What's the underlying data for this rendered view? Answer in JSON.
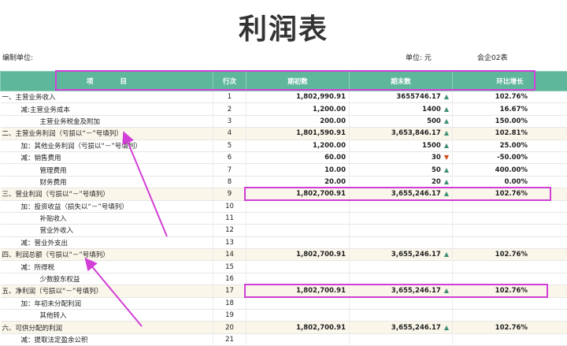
{
  "title": "利润表",
  "meta": {
    "unit_left": "编制单位:",
    "unit": "单位: 元",
    "code": "会企02表"
  },
  "headers": {
    "item": "项　　　　目",
    "line": "行次",
    "begin": "期初数",
    "end": "期末数",
    "growth": "环比增长"
  },
  "rows": [
    {
      "item": "一、主营业务收入",
      "line": "1",
      "begin": "1,802,990.91",
      "end": "3655746.17",
      "dir": "up",
      "growth": "102.76%",
      "indent": 0,
      "hl": false
    },
    {
      "item": "减:主营业务成本",
      "line": "2",
      "begin": "1,200.00",
      "end": "1400",
      "dir": "up",
      "growth": "16.67%",
      "indent": 1,
      "hl": false
    },
    {
      "item": "主营业务税金及附加",
      "line": "3",
      "begin": "200.00",
      "end": "500",
      "dir": "up",
      "growth": "150.00%",
      "indent": 2,
      "hl": false
    },
    {
      "item": "二、主营业务利润（亏损以“－”号填列）",
      "line": "4",
      "begin": "1,801,590.91",
      "end": "3,653,846.17",
      "dir": "up",
      "growth": "102.81%",
      "indent": 0,
      "hl": true
    },
    {
      "item": "加：其他业务利润（亏损以“－”号填列）",
      "line": "5",
      "begin": "1,200.00",
      "end": "1500",
      "dir": "up",
      "growth": "25.00%",
      "indent": 1,
      "hl": false
    },
    {
      "item": "减：销售费用",
      "line": "6",
      "begin": "60.00",
      "end": "30",
      "dir": "down",
      "growth": "-50.00%",
      "indent": 1,
      "hl": false
    },
    {
      "item": "管理费用",
      "line": "7",
      "begin": "10.00",
      "end": "50",
      "dir": "up",
      "growth": "400.00%",
      "indent": 2,
      "hl": false
    },
    {
      "item": "财务费用",
      "line": "8",
      "begin": "20.00",
      "end": "20",
      "dir": "up",
      "growth": "0.00%",
      "indent": 2,
      "hl": false
    },
    {
      "item": "三、营业利润（亏损以“－”号填列）",
      "line": "9",
      "begin": "1,802,700.91",
      "end": "3,655,246.17",
      "dir": "up",
      "growth": "102.76%",
      "indent": 0,
      "hl": true
    },
    {
      "item": "加：投资收益（损失以“－”号填列）",
      "line": "10",
      "begin": "",
      "end": "",
      "dir": "",
      "growth": "",
      "indent": 1,
      "hl": false
    },
    {
      "item": "补贴收入",
      "line": "11",
      "begin": "",
      "end": "",
      "dir": "",
      "growth": "",
      "indent": 2,
      "hl": false
    },
    {
      "item": "营业外收入",
      "line": "12",
      "begin": "",
      "end": "",
      "dir": "",
      "growth": "",
      "indent": 2,
      "hl": false
    },
    {
      "item": "减：营业外支出",
      "line": "13",
      "begin": "",
      "end": "",
      "dir": "",
      "growth": "",
      "indent": 1,
      "hl": false
    },
    {
      "item": "四、利润总额（亏损以“－”号填列）",
      "line": "14",
      "begin": "1,802,700.91",
      "end": "3,655,246.17",
      "dir": "up",
      "growth": "102.76%",
      "indent": 0,
      "hl": true
    },
    {
      "item": "减：所得税",
      "line": "15",
      "begin": "",
      "end": "",
      "dir": "",
      "growth": "",
      "indent": 1,
      "hl": false
    },
    {
      "item": "少数股东权益",
      "line": "16",
      "begin": "",
      "end": "",
      "dir": "",
      "growth": "",
      "indent": 2,
      "hl": false
    },
    {
      "item": "五、净利润（亏损以“－”号填列）",
      "line": "17",
      "begin": "1,802,700.91",
      "end": "3,655,246.17",
      "dir": "up",
      "growth": "102.76%",
      "indent": 0,
      "hl": true
    },
    {
      "item": "加：年初未分配利润",
      "line": "18",
      "begin": "",
      "end": "",
      "dir": "",
      "growth": "",
      "indent": 1,
      "hl": false
    },
    {
      "item": "其他转入",
      "line": "19",
      "begin": "",
      "end": "",
      "dir": "",
      "growth": "",
      "indent": 2,
      "hl": false
    },
    {
      "item": "六、可供分配的利润",
      "line": "20",
      "begin": "1,802,700.91",
      "end": "3,655,246.17",
      "dir": "up",
      "growth": "102.76%",
      "indent": 0,
      "hl": true
    },
    {
      "item": "减：提取法定盈余公积",
      "line": "21",
      "begin": "",
      "end": "",
      "dir": "",
      "growth": "",
      "indent": 1,
      "hl": false
    }
  ],
  "colors": {
    "header": "#5fb79b",
    "highlight": "#fbf6ea",
    "annotation": "#d23fd6",
    "up": "#3f8f73",
    "down": "#d04a1a"
  },
  "icons": {
    "up": "up-arrow-icon",
    "down": "down-arrow-icon"
  }
}
